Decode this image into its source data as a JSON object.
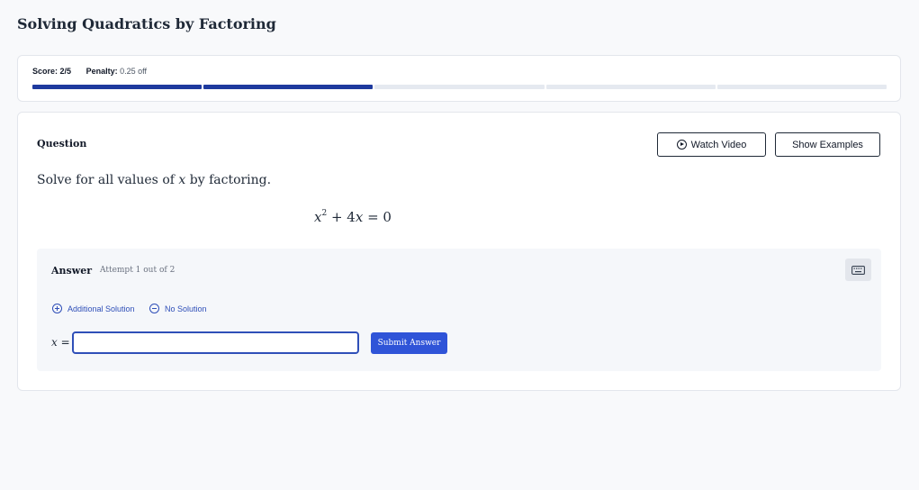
{
  "page": {
    "title": "Solving Quadratics by Factoring"
  },
  "score": {
    "score_label": "Score:",
    "score_value": "2/5",
    "penalty_label": "Penalty:",
    "penalty_value": "0.25 off",
    "progress": {
      "total_segments": 5,
      "completed_segments": 2
    },
    "colors": {
      "completed": "#1e3a9e",
      "remaining": "#e5e9f0"
    }
  },
  "question": {
    "heading": "Question",
    "watch_video_label": "Watch Video",
    "show_examples_label": "Show Examples",
    "prompt_before": "Solve for all values of ",
    "prompt_var": "x",
    "prompt_after": " by factoring.",
    "equation": {
      "var": "x",
      "exponent": "2",
      "middle": " + 4",
      "var2": "x",
      "rhs": " = 0"
    }
  },
  "answer": {
    "label": "Answer",
    "attempt_text": "Attempt 1 out of 2",
    "keyboard_icon": "keyboard-icon",
    "additional_solution_label": "Additional Solution",
    "no_solution_label": "No Solution",
    "input_var": "x",
    "input_eq": " =",
    "input_value": "",
    "submit_label": "Submit Answer",
    "accent_color": "#2f54d8"
  }
}
